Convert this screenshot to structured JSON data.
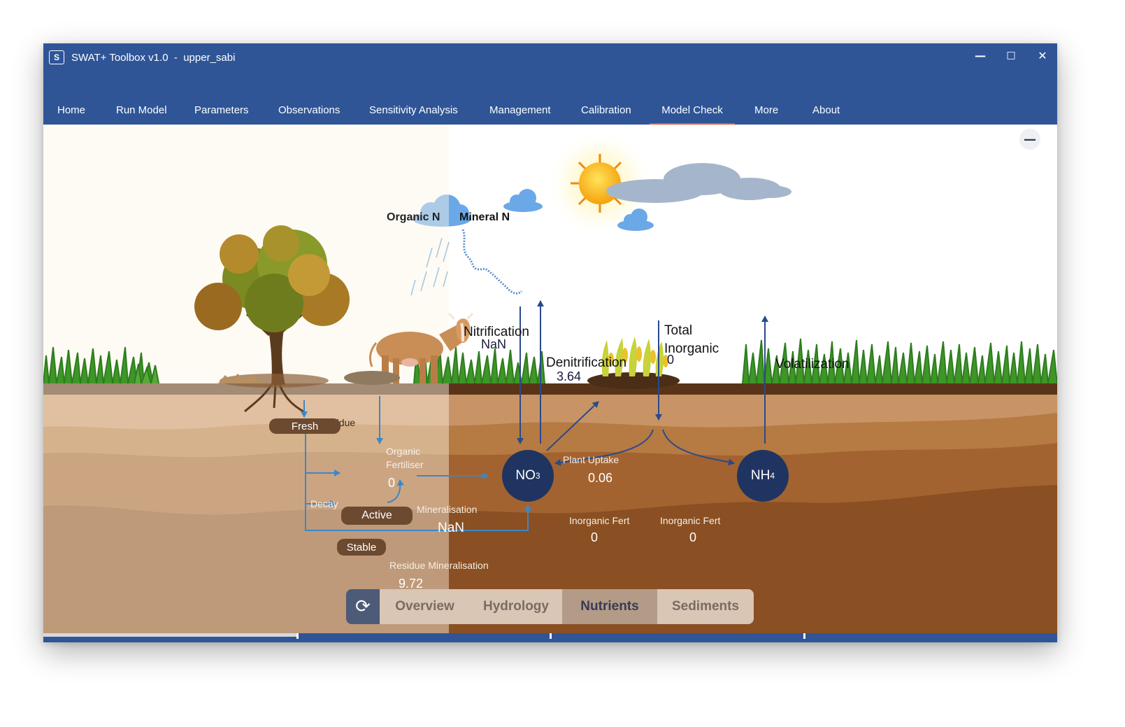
{
  "window": {
    "logo_text": "S",
    "title": "SWAT+ Toolbox v1.0  -  upper_sabi",
    "min_icon": "minimize-icon",
    "max_icon": "maximize-icon",
    "close_icon": "close-icon"
  },
  "tabs": [
    {
      "label": "Home"
    },
    {
      "label": "Run Model"
    },
    {
      "label": "Parameters"
    },
    {
      "label": "Observations"
    },
    {
      "label": "Sensitivity Analysis"
    },
    {
      "label": "Management"
    },
    {
      "label": "Calibration"
    },
    {
      "label": "Model Check",
      "active": true
    },
    {
      "label": "More"
    },
    {
      "label": "About"
    }
  ],
  "diagram": {
    "organic_n": "Organic N",
    "mineral_n": "Mineral N",
    "nitrification": {
      "label": "Nitrification",
      "value": "NaN"
    },
    "denitrification": {
      "label": "Denitrification",
      "value": "3.64"
    },
    "total_inorganic": {
      "label": "Total\nInorganic",
      "value": "0"
    },
    "volatilization": {
      "label": "Volatilization"
    },
    "plant_residue": "Plant Residue",
    "fresh": "Fresh",
    "organic_fertiliser": {
      "label": "Organic\nFertiliser",
      "value": "0"
    },
    "decay": "Decay",
    "active": "Active",
    "stable": "Stable",
    "mineralisation": {
      "label": "Mineralisation",
      "value": "NaN"
    },
    "residue_mineralisation": {
      "label": "Residue Mineralisation",
      "value": "9.72"
    },
    "plant_uptake": {
      "label": "Plant Uptake",
      "value": "0.06"
    },
    "inorganic_fert_1": {
      "label": "Inorganic Fert",
      "value": "0"
    },
    "inorganic_fert_2": {
      "label": "Inorganic Fert",
      "value": "0"
    },
    "no3": {
      "base": "NO",
      "sub": "3"
    },
    "nh4": {
      "base": "NH",
      "sub": "4"
    }
  },
  "bottom_nav": {
    "refresh_icon": "refresh-icon",
    "items": [
      {
        "label": "Overview"
      },
      {
        "label": "Hydrology"
      },
      {
        "label": "Nutrients",
        "active": true
      },
      {
        "label": "Sediments"
      }
    ]
  },
  "controls": {
    "collapse_icon": "minus-icon"
  },
  "colors": {
    "titlebar": "#2f5597",
    "active_tab_underline": "#e35d3a",
    "node_fill": "#1f3461",
    "arrow": "#2a4a8a",
    "soil_dark": "#8a4f22",
    "organic_panel": "#fdf6e6"
  }
}
